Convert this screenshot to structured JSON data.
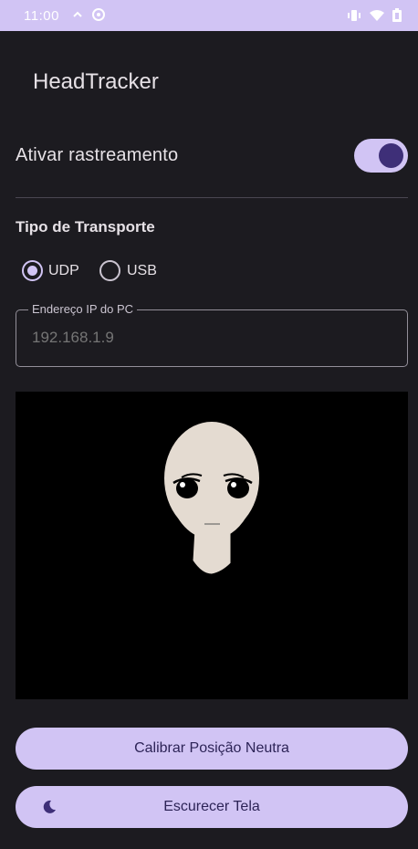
{
  "status_bar": {
    "time": "11:00",
    "left_icons": [
      "cloud-icon",
      "sync-icon"
    ],
    "right_icons": [
      "vibrate-icon",
      "wifi-icon",
      "battery-icon"
    ]
  },
  "app": {
    "title": "HeadTracker"
  },
  "tracking": {
    "label": "Ativar rastreamento",
    "enabled": true
  },
  "transport": {
    "title": "Tipo de Transporte",
    "options": [
      {
        "label": "UDP",
        "selected": true
      },
      {
        "label": "USB",
        "selected": false
      }
    ]
  },
  "ip_field": {
    "label": "Endereço IP do PC",
    "placeholder": "192.168.1.9"
  },
  "preview": {
    "icon": "anime-face-avatar"
  },
  "buttons": {
    "calibrate": "Calibrar Posição Neutra",
    "dim_screen": "Escurecer Tela",
    "dim_screen_icon": "moon-icon"
  },
  "colors": {
    "accent": "#d1c4f4",
    "accent_dark": "#3e2f78",
    "background": "#1c1b20"
  }
}
